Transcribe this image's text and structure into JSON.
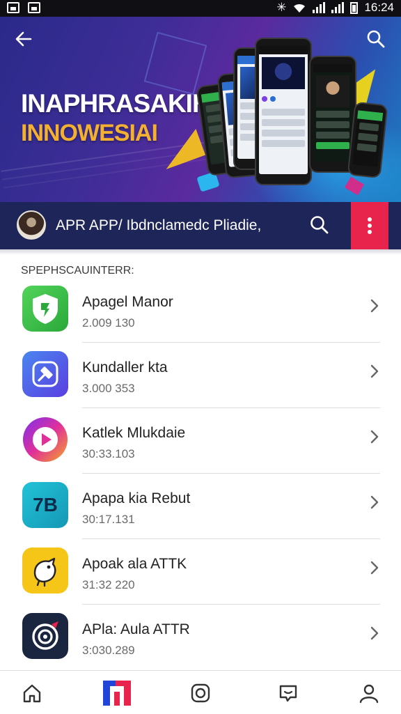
{
  "status_bar": {
    "time": "16:24"
  },
  "header": {
    "title": "INAPHRASAKIH",
    "subtitle": "INNOWESIAI"
  },
  "profile_bar": {
    "text": "APR APP/ Ibdnclamedc Pliadie,"
  },
  "section": {
    "label": "SPEPHSCAUINTERR:"
  },
  "apps": [
    {
      "name": "Apagel Manor",
      "meta": "2.009 130",
      "icon": "shield-app-icon",
      "color": "#3cc34a"
    },
    {
      "name": "Kundaller kta",
      "meta": "3.000 353",
      "icon": "hammer-app-icon",
      "color": "#3a5fe0"
    },
    {
      "name": "Katlek Mlukdaie",
      "meta": "30:33.103",
      "icon": "play-app-icon",
      "color": "#d62fa0"
    },
    {
      "name": "Apapa kia Rebut",
      "meta": "30:17.131",
      "icon": "7b-app-icon",
      "icon_text": "7B",
      "color": "#1ab0c8"
    },
    {
      "name": "Apoak ala ATTK",
      "meta": "31:32 220",
      "icon": "bird-app-icon",
      "color": "#f5c518"
    },
    {
      "name": "APla: Aula ATTR",
      "meta": "3:030.289",
      "icon": "spiral-app-icon",
      "color": "#1a2540"
    }
  ],
  "bottom_nav": [
    "home-icon",
    "store-icon",
    "camera-icon",
    "chat-icon",
    "profile-icon"
  ],
  "colors": {
    "profile_bar": "#1e2559",
    "accent": "#e8244d"
  }
}
